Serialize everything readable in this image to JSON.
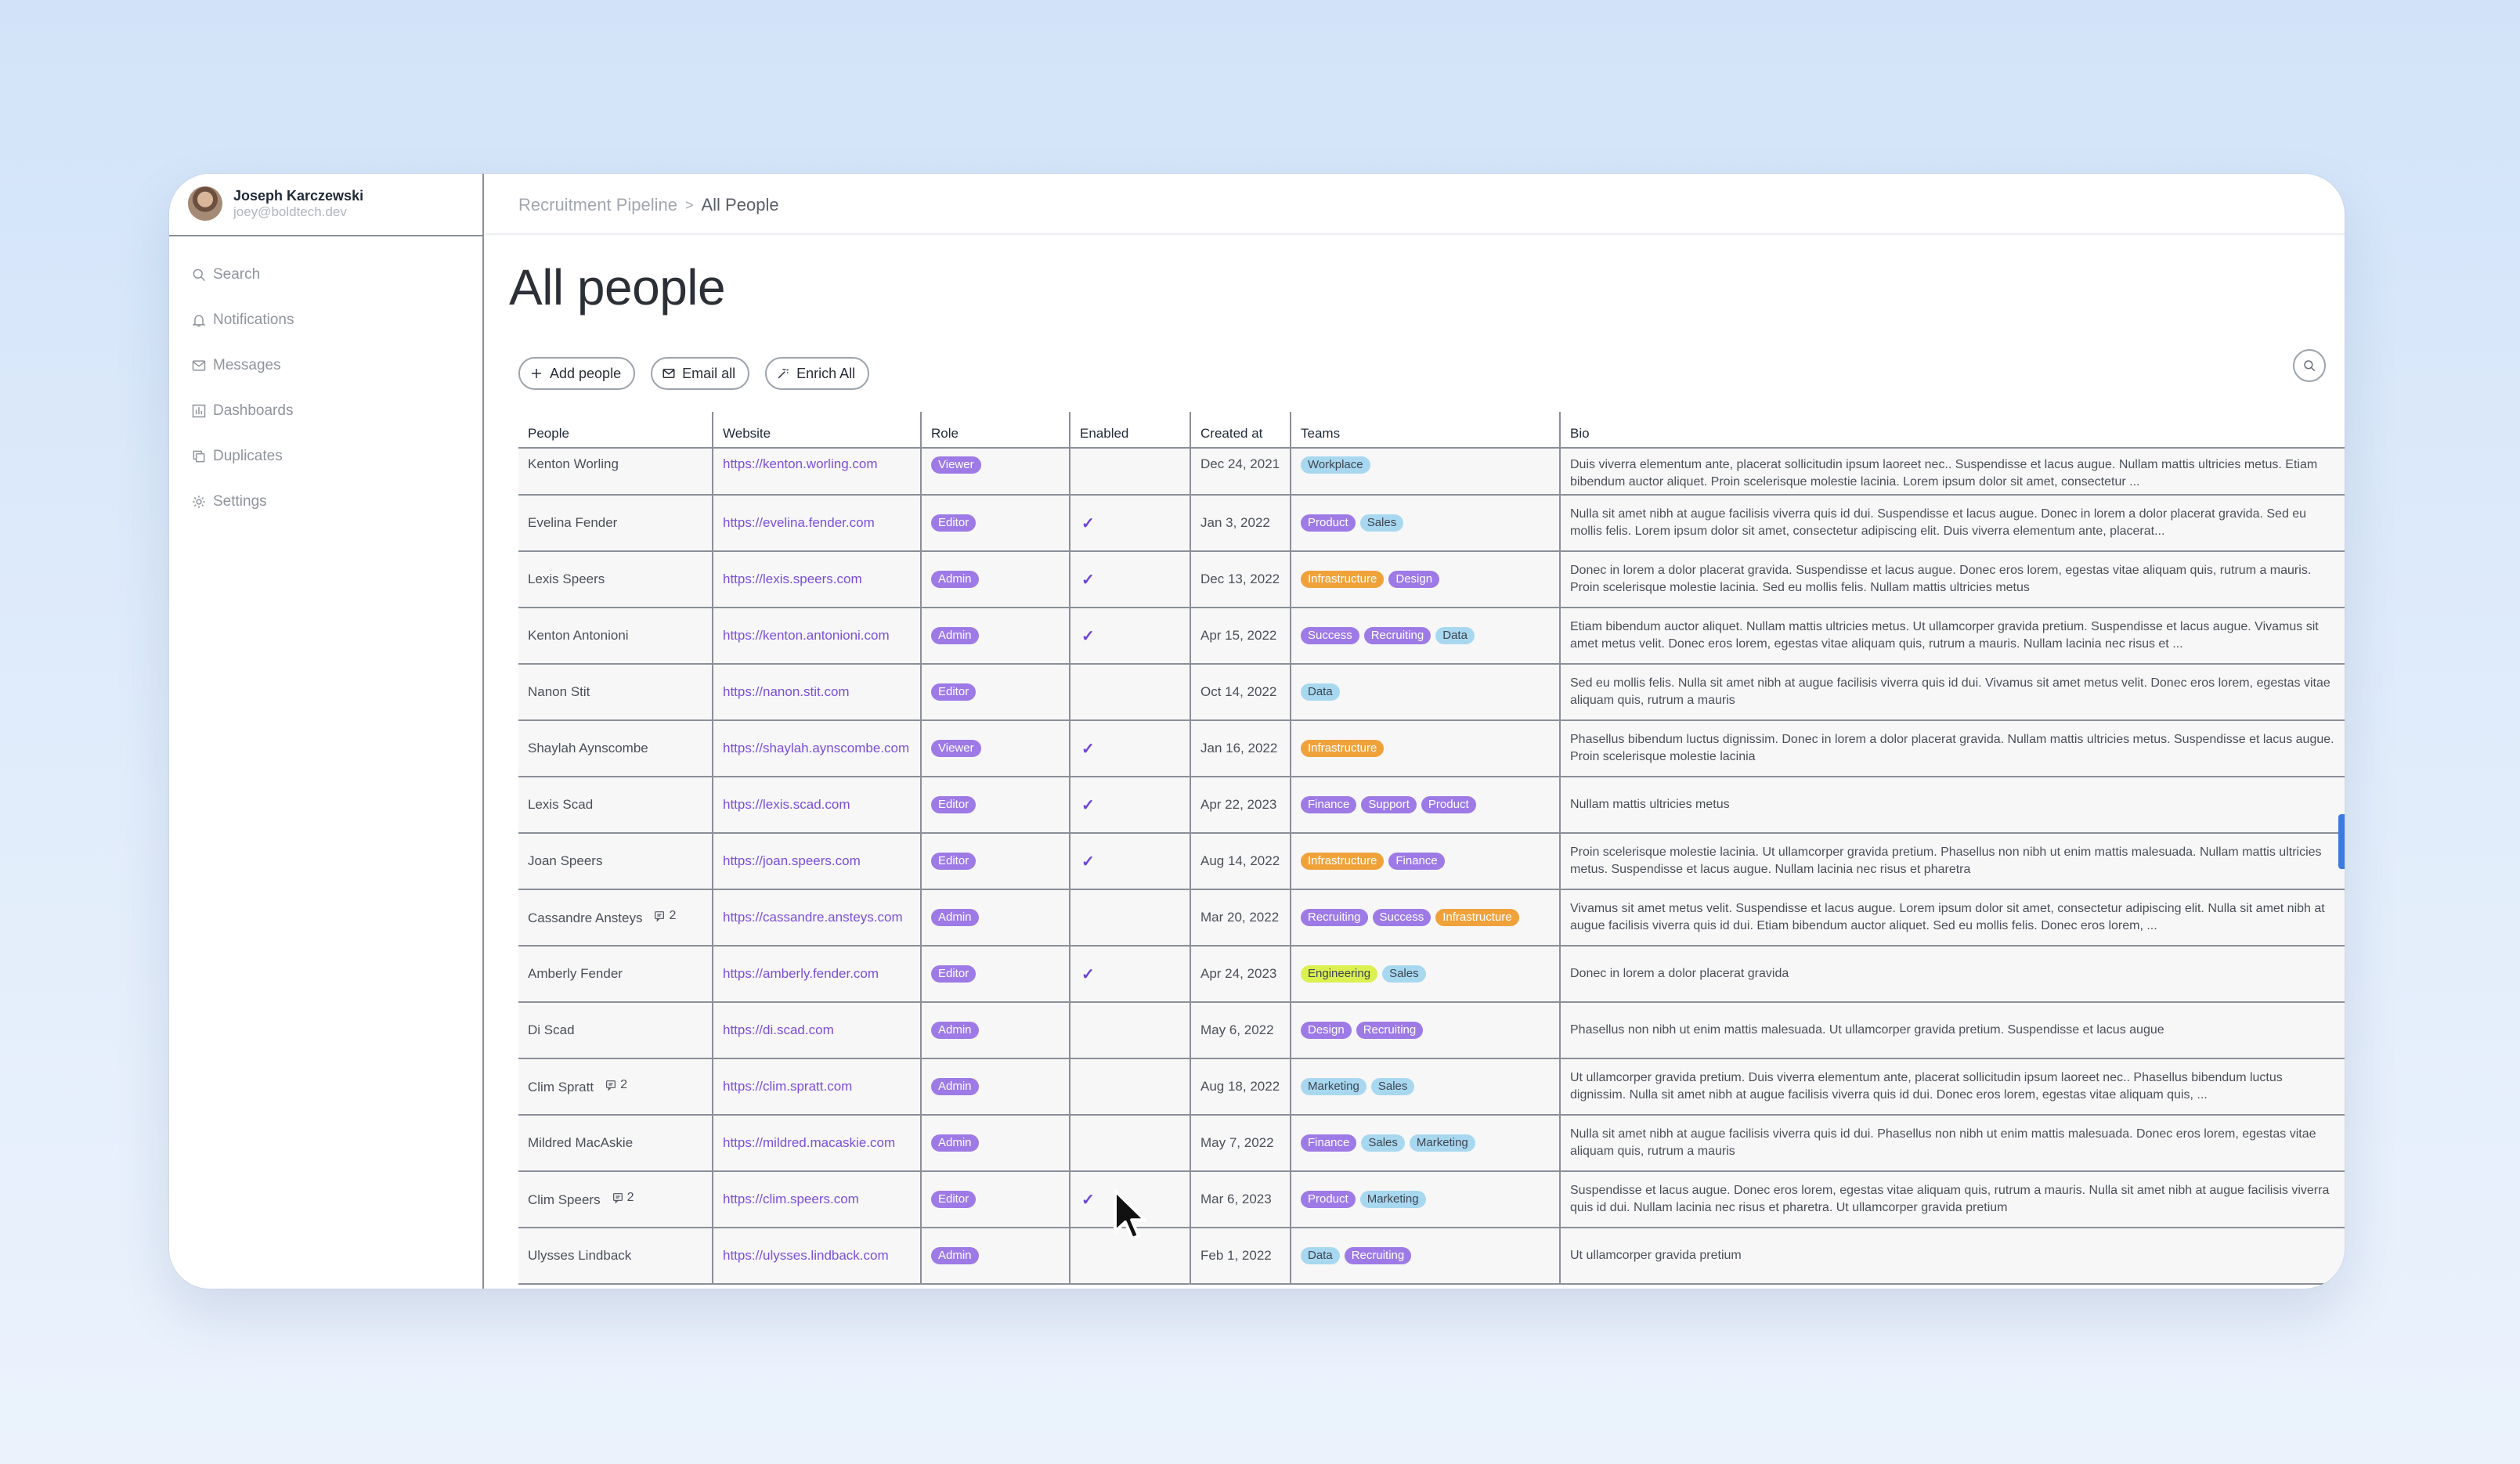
{
  "user": {
    "name": "Joseph Karczewski",
    "email": "joey@boldtech.dev"
  },
  "sidebar": {
    "items": [
      {
        "label": "Search",
        "icon": "search-icon"
      },
      {
        "label": "Notifications",
        "icon": "bell-icon"
      },
      {
        "label": "Messages",
        "icon": "mail-icon"
      },
      {
        "label": "Dashboards",
        "icon": "chart-icon"
      },
      {
        "label": "Duplicates",
        "icon": "copy-icon"
      },
      {
        "label": "Settings",
        "icon": "gear-icon"
      }
    ]
  },
  "breadcrumb": {
    "parent": "Recruitment Pipeline",
    "separator": ">",
    "current": "All People"
  },
  "page": {
    "title": "All people"
  },
  "actions": {
    "add": "Add people",
    "email": "Email all",
    "enrich": "Enrich All"
  },
  "colors": {
    "purple": "#9d7ae6",
    "orange": "#f0a23a",
    "lightblue": "#a8d8f0",
    "lime": "#dcf050",
    "accent_link": "#7a4ed8",
    "check": "#6b44d6",
    "scroll": "#3b7be0"
  },
  "table": {
    "columns": [
      "People",
      "Website",
      "Role",
      "Enabled",
      "Created at",
      "Teams",
      "Bio"
    ],
    "rows": [
      {
        "name": "Kenton Worling",
        "website": "https://kenton.worling.com",
        "role": "Viewer",
        "enabled": false,
        "created": "Dec 24, 2021",
        "teams": [
          "Workplace"
        ],
        "bio": "Duis viverra elementum ante, placerat sollicitudin ipsum laoreet nec.. Suspendisse et lacus augue. Nullam mattis ultricies metus. Etiam bibendum auctor aliquet. Proin scelerisque molestie lacinia. Lorem ipsum dolor sit amet, consectetur ...",
        "comments": ""
      },
      {
        "name": "Evelina Fender",
        "website": "https://evelina.fender.com",
        "role": "Editor",
        "enabled": true,
        "created": "Jan 3, 2022",
        "teams": [
          "Product",
          "Sales"
        ],
        "bio": "Nulla sit amet nibh at augue facilisis viverra quis id dui. Suspendisse et lacus augue. Donec in lorem a dolor placerat gravida. Sed eu mollis felis. Lorem ipsum dolor sit amet, consectetur adipiscing elit. Duis viverra elementum ante, placerat...",
        "comments": ""
      },
      {
        "name": "Lexis Speers",
        "website": "https://lexis.speers.com",
        "role": "Admin",
        "enabled": true,
        "created": "Dec 13, 2022",
        "teams": [
          "Infrastructure",
          "Design"
        ],
        "bio": "Donec in lorem a dolor placerat gravida. Suspendisse et lacus augue. Donec eros lorem, egestas vitae aliquam quis, rutrum a mauris. Proin scelerisque molestie lacinia. Sed eu mollis felis. Nullam mattis ultricies metus",
        "comments": ""
      },
      {
        "name": "Kenton Antonioni",
        "website": "https://kenton.antonioni.com",
        "role": "Admin",
        "enabled": true,
        "created": "Apr 15, 2022",
        "teams": [
          "Success",
          "Recruiting",
          "Data"
        ],
        "bio": "Etiam bibendum auctor aliquet. Nullam mattis ultricies metus. Ut ullamcorper gravida pretium. Suspendisse et lacus augue. Vivamus sit amet metus velit. Donec eros lorem, egestas vitae aliquam quis, rutrum a mauris. Nullam lacinia nec risus et ...",
        "comments": ""
      },
      {
        "name": "Nanon Stit",
        "website": "https://nanon.stit.com",
        "role": "Editor",
        "enabled": false,
        "created": "Oct 14, 2022",
        "teams": [
          "Data"
        ],
        "bio": "Sed eu mollis felis. Nulla sit amet nibh at augue facilisis viverra quis id dui. Vivamus sit amet metus velit. Donec eros lorem, egestas vitae aliquam quis, rutrum a mauris",
        "comments": ""
      },
      {
        "name": "Shaylah Aynscombe",
        "website": "https://shaylah.aynscombe.com",
        "role": "Viewer",
        "enabled": true,
        "created": "Jan 16, 2022",
        "teams": [
          "Infrastructure"
        ],
        "bio": "Phasellus bibendum luctus dignissim. Donec in lorem a dolor placerat gravida. Nullam mattis ultricies metus. Suspendisse et lacus augue. Proin scelerisque molestie lacinia",
        "comments": ""
      },
      {
        "name": "Lexis Scad",
        "website": "https://lexis.scad.com",
        "role": "Editor",
        "enabled": true,
        "created": "Apr 22, 2023",
        "teams": [
          "Finance",
          "Support",
          "Product"
        ],
        "bio": "Nullam mattis ultricies metus",
        "comments": ""
      },
      {
        "name": "Joan Speers",
        "website": "https://joan.speers.com",
        "role": "Editor",
        "enabled": true,
        "created": "Aug 14, 2022",
        "teams": [
          "Infrastructure",
          "Finance"
        ],
        "bio": "Proin scelerisque molestie lacinia. Ut ullamcorper gravida pretium. Phasellus non nibh ut enim mattis malesuada. Nullam mattis ultricies metus. Suspendisse et lacus augue. Nullam lacinia nec risus et pharetra",
        "comments": ""
      },
      {
        "name": "Cassandre Ansteys",
        "website": "https://cassandre.ansteys.com",
        "role": "Admin",
        "enabled": false,
        "created": "Mar 20, 2022",
        "teams": [
          "Recruiting",
          "Success",
          "Infrastructure"
        ],
        "bio": "Vivamus sit amet metus velit. Suspendisse et lacus augue. Lorem ipsum dolor sit amet, consectetur adipiscing elit. Nulla sit amet nibh at augue facilisis viverra quis id dui. Etiam bibendum auctor aliquet. Sed eu mollis felis. Donec eros lorem, ...",
        "comments": "2"
      },
      {
        "name": "Amberly Fender",
        "website": "https://amberly.fender.com",
        "role": "Editor",
        "enabled": true,
        "created": "Apr 24, 2023",
        "teams": [
          "Engineering",
          "Sales"
        ],
        "bio": "Donec in lorem a dolor placerat gravida",
        "comments": ""
      },
      {
        "name": "Di Scad",
        "website": "https://di.scad.com",
        "role": "Admin",
        "enabled": false,
        "created": "May 6, 2022",
        "teams": [
          "Design",
          "Recruiting"
        ],
        "bio": "Phasellus non nibh ut enim mattis malesuada. Ut ullamcorper gravida pretium. Suspendisse et lacus augue",
        "comments": ""
      },
      {
        "name": "Clim Spratt",
        "website": "https://clim.spratt.com",
        "role": "Admin",
        "enabled": false,
        "created": "Aug 18, 2022",
        "teams": [
          "Marketing",
          "Sales"
        ],
        "bio": "Ut ullamcorper gravida pretium. Duis viverra elementum ante, placerat sollicitudin ipsum laoreet nec.. Phasellus bibendum luctus dignissim. Nulla sit amet nibh at augue facilisis viverra quis id dui. Donec eros lorem, egestas vitae aliquam quis, ...",
        "comments": "2"
      },
      {
        "name": "Mildred MacAskie",
        "website": "https://mildred.macaskie.com",
        "role": "Admin",
        "enabled": false,
        "created": "May 7, 2022",
        "teams": [
          "Finance",
          "Sales",
          "Marketing"
        ],
        "bio": "Nulla sit amet nibh at augue facilisis viverra quis id dui. Phasellus non nibh ut enim mattis malesuada. Donec eros lorem, egestas vitae aliquam quis, rutrum a mauris",
        "comments": ""
      },
      {
        "name": "Clim Speers",
        "website": "https://clim.speers.com",
        "role": "Editor",
        "enabled": true,
        "created": "Mar 6, 2023",
        "teams": [
          "Product",
          "Marketing"
        ],
        "bio": "Suspendisse et lacus augue. Donec eros lorem, egestas vitae aliquam quis, rutrum a mauris. Nulla sit amet nibh at augue facilisis viverra quis id dui. Nullam lacinia nec risus et pharetra. Ut ullamcorper gravida pretium",
        "comments": "2"
      },
      {
        "name": "Ulysses Lindback",
        "website": "https://ulysses.lindback.com",
        "role": "Admin",
        "enabled": false,
        "created": "Feb 1, 2022",
        "teams": [
          "Data",
          "Recruiting"
        ],
        "bio": "Ut ullamcorper gravida pretium",
        "comments": ""
      }
    ]
  },
  "team_colors": {
    "Workplace": "lightblue",
    "Product": "purple",
    "Sales": "lightblue",
    "Infrastructure": "orange",
    "Design": "purple",
    "Success": "purple",
    "Recruiting": "purple",
    "Data": "lightblue",
    "Finance": "purple",
    "Support": "purple",
    "Engineering": "lime",
    "Marketing": "lightblue"
  }
}
